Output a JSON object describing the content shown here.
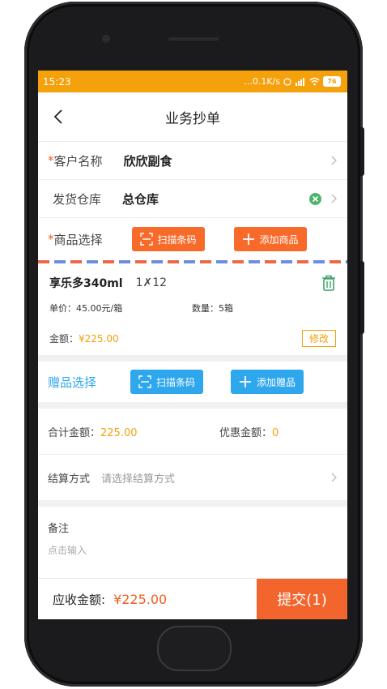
{
  "status_bar": {
    "time": "15:23",
    "network_speed": "...0.1K/s",
    "signal": "4G",
    "battery": "76"
  },
  "navbar": {
    "title": "业务抄单"
  },
  "form": {
    "customer": {
      "required_mark": "*",
      "label": "客户名称",
      "value": "欣欣副食"
    },
    "warehouse": {
      "label": "发货仓库",
      "value": "总仓库"
    },
    "product_select": {
      "required_mark": "*",
      "label": "商品选择",
      "scan_label": "扫描条码",
      "add_label": "添加商品"
    }
  },
  "product_item": {
    "name": "享乐多340ml",
    "qty_multiplier": "1✗12",
    "unit_price_label": "单价：45.00元/箱",
    "quantity_label": "数量：5箱",
    "amount_label": "金额：",
    "amount_value": "¥225.00",
    "edit_label": "修改"
  },
  "gift": {
    "label": "赠品选择",
    "scan_label": "扫描条码",
    "add_label": "添加赠品"
  },
  "totals": {
    "total_label": "合计金额：",
    "total_value": "225.00",
    "discount_label": "优惠金额：",
    "discount_value": "0"
  },
  "payment": {
    "label": "结算方式",
    "placeholder": "请选择结算方式"
  },
  "memo": {
    "label": "备注",
    "placeholder": "点击输入"
  },
  "footer": {
    "receivable_label": "应收金额:",
    "receivable_value": "¥225.00",
    "submit_label": "提交(1)"
  },
  "colors": {
    "status_bar": "#f4a10c",
    "primary_orange": "#f86a2a",
    "primary_blue": "#2fa7ed",
    "amount_color": "#f4a10c"
  }
}
